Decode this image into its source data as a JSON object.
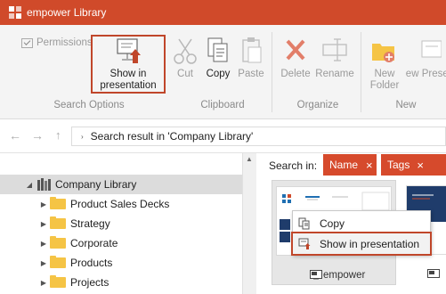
{
  "app": {
    "title": "empower Library"
  },
  "ribbon": {
    "permissions": "Permissions",
    "show_in_presentation": "Show in presentation",
    "cut": "Cut",
    "copy": "Copy",
    "paste": "Paste",
    "delete": "Delete",
    "rename": "Rename",
    "new_folder": "New Folder",
    "new_presentation": "New Present",
    "groups": {
      "search_options": "Search Options",
      "clipboard": "Clipboard",
      "organize": "Organize",
      "new": "New"
    }
  },
  "address": {
    "path": "Search result in 'Company Library'"
  },
  "search": {
    "label": "Search in:",
    "filters": [
      {
        "label": "Name",
        "close": "×"
      },
      {
        "label": "Tags",
        "close": "×"
      }
    ]
  },
  "tree": {
    "root": "Company Library",
    "items": [
      {
        "label": "Product Sales Decks"
      },
      {
        "label": "Strategy"
      },
      {
        "label": "Corporate"
      },
      {
        "label": "Products"
      },
      {
        "label": "Projects"
      }
    ]
  },
  "results": {
    "card1_label": "empower"
  },
  "context_menu": {
    "items": [
      {
        "label": "Copy"
      },
      {
        "label": "Show in presentation"
      }
    ]
  },
  "colors": {
    "accent": "#d04a2a",
    "highlight": "#c0462a"
  }
}
